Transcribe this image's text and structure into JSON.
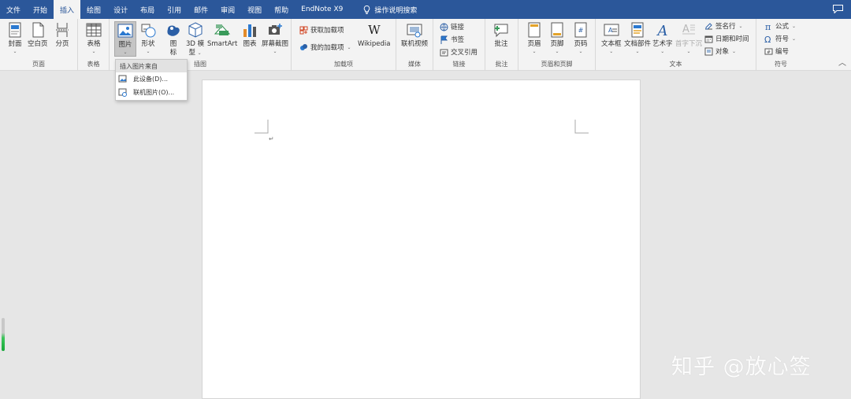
{
  "menubar": {
    "tabs": [
      "文件",
      "开始",
      "插入",
      "绘图",
      "设计",
      "布局",
      "引用",
      "邮件",
      "审阅",
      "视图",
      "帮助",
      "EndNote X9"
    ],
    "search": "操作说明搜索"
  },
  "ribbon": {
    "groups": {
      "pages": {
        "label": "页面",
        "cover": "封面",
        "blank": "空白页",
        "pagebreak": "分页"
      },
      "tables": {
        "label": "表格",
        "table": "表格"
      },
      "illustrations": {
        "label": "插图",
        "picture": "图片",
        "shapes": "形状",
        "icons_1": "图",
        "icons_2": "标",
        "model_1": "3D 模",
        "model_2": "型",
        "smartart": "SmartArt",
        "chart": "图表",
        "screenshot": "屏幕截图"
      },
      "addins": {
        "label": "加载项",
        "get": "获取加载项",
        "my": "我的加载项",
        "wikipedia": "Wikipedia"
      },
      "media": {
        "label": "媒体",
        "online_video": "联机视频"
      },
      "links": {
        "label": "链接",
        "link": "链接",
        "bookmark": "书签",
        "crossref": "交叉引用"
      },
      "comments": {
        "label": "批注",
        "comment": "批注"
      },
      "header_footer": {
        "label": "页眉和页脚",
        "header": "页眉",
        "footer": "页脚",
        "page_number": "页码"
      },
      "text": {
        "label": "文本",
        "textbox": "文本框",
        "quickparts": "文档部件",
        "wordart": "艺术字",
        "dropcap": "首字下沉",
        "signature": "签名行",
        "datetime": "日期和时间",
        "object": "对象"
      },
      "symbols": {
        "label": "符号",
        "equation": "公式",
        "symbol": "符号",
        "number": "编号"
      }
    }
  },
  "dropdown": {
    "header": "插入图片来自",
    "this_device": "此设备(D)...",
    "online": "联机图片(O)..."
  },
  "document": {
    "para_mark": "↵"
  },
  "watermark": "知乎 @放心签",
  "colors": {
    "accent": "#2b579a",
    "ribbon_bg": "#f3f3f3",
    "workspace_bg": "#e6e6e6"
  }
}
